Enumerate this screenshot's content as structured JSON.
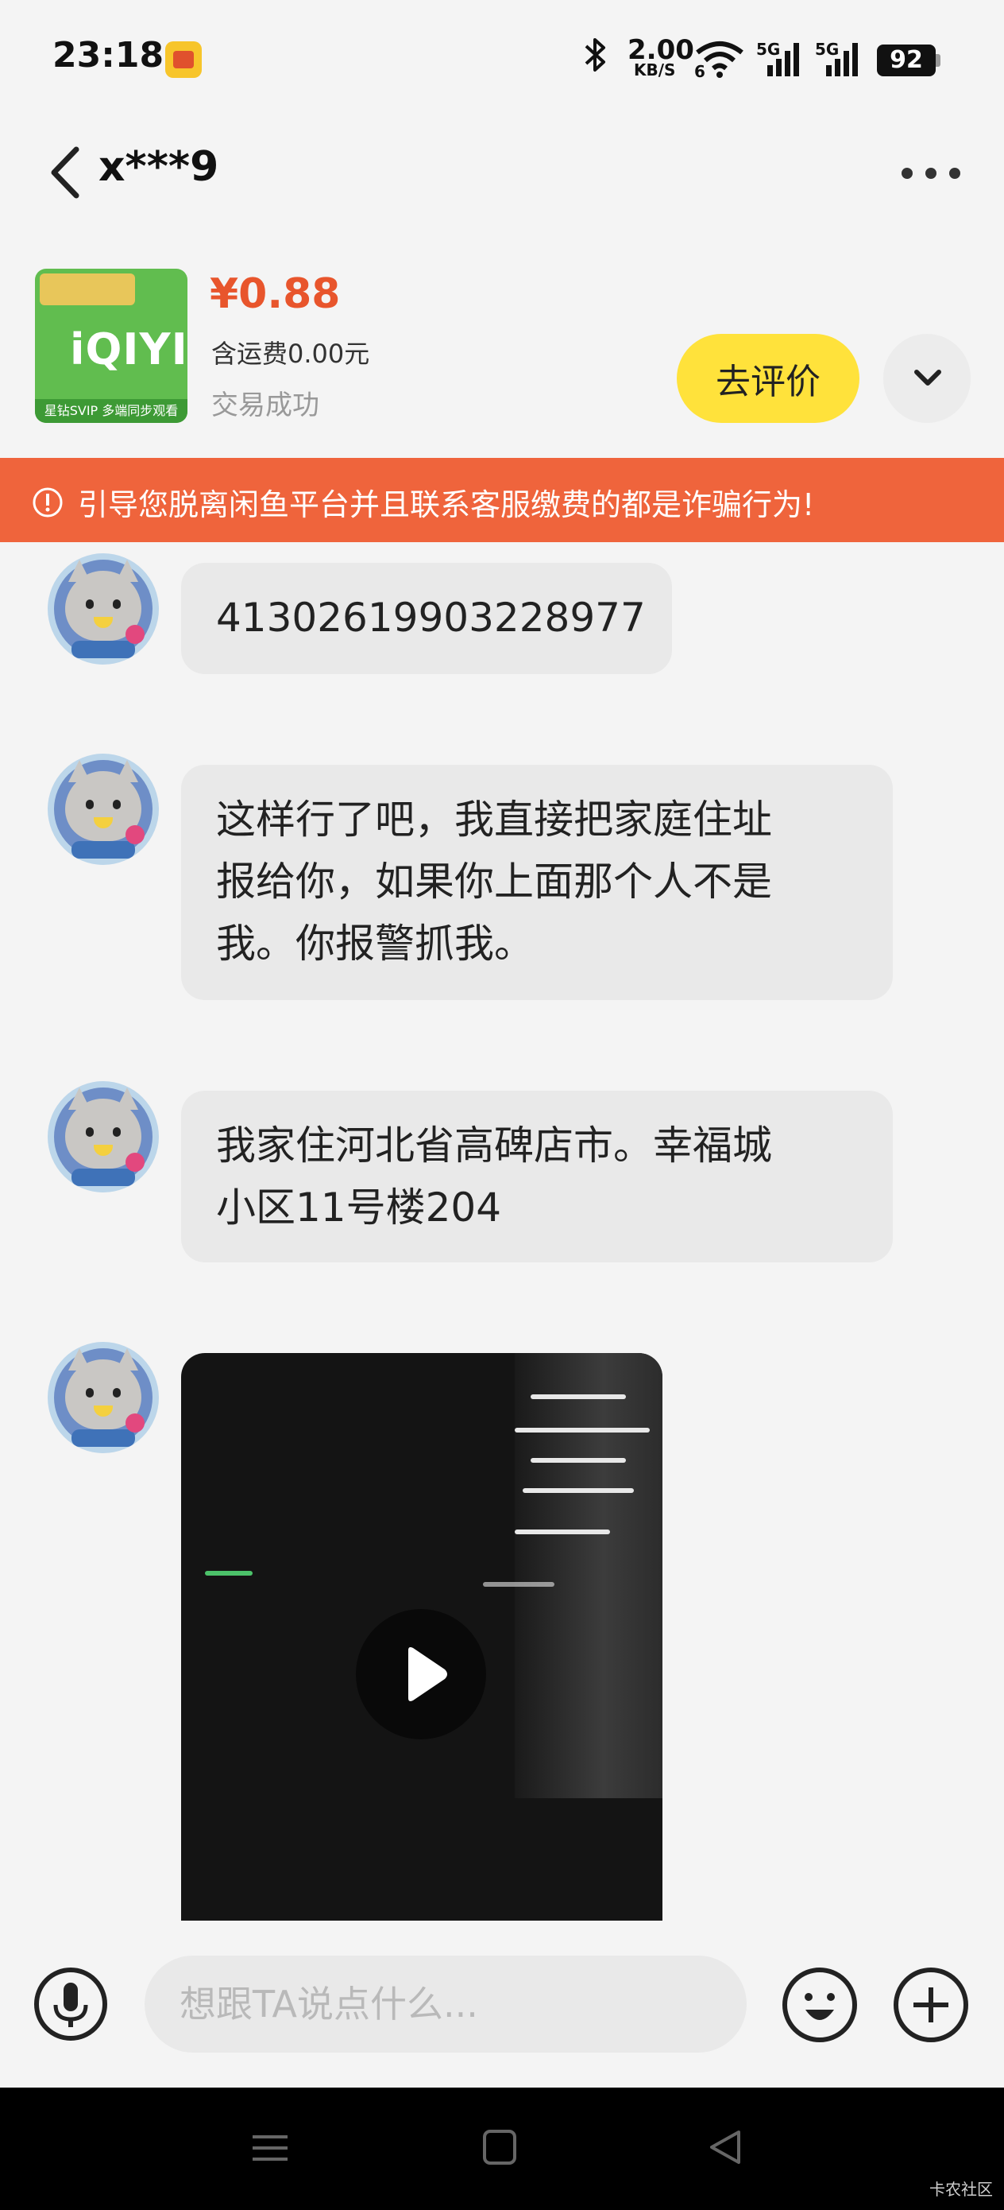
{
  "status_bar": {
    "time": "23:18",
    "network_speed": "2.00",
    "network_speed_unit": "KB/S",
    "signal_1_label": "5G",
    "signal_2_label": "5G",
    "wifi_level_label": "6",
    "battery": "92",
    "bluetooth_icon": "bluetooth-icon",
    "app_badge_icon": "app-badge-icon"
  },
  "header": {
    "title": "x***9",
    "back_icon": "back-chevron-icon",
    "more_icon": "more-icon"
  },
  "product": {
    "image_logo": "iQIYI",
    "image_caption": "星钻SVIP 多端同步观看",
    "price": "¥0.88",
    "shipping": "含运费0.00元",
    "status": "交易成功",
    "review_button": "去评价"
  },
  "warning": {
    "text": "引导您脱离闲鱼平台并且联系客服缴费的都是诈骗行为!",
    "background": "#ef643c"
  },
  "messages": [
    {
      "type": "text",
      "text": "41302619903228977"
    },
    {
      "type": "text",
      "text": "这样行了吧，我直接把家庭住址\n报给你，如果你上面那个人不是\n我。你报警抓我。"
    },
    {
      "type": "text",
      "text": "我家住河北省高碑店市。幸福城\n小区11号楼204"
    },
    {
      "type": "video"
    }
  ],
  "input": {
    "placeholder": "想跟TA说点什么..."
  },
  "nav": {
    "watermark": "卡农社区"
  },
  "colors": {
    "accent_yellow": "#ffe23b",
    "price_orange": "#e8552c",
    "bubble": "#e9e9e9"
  }
}
